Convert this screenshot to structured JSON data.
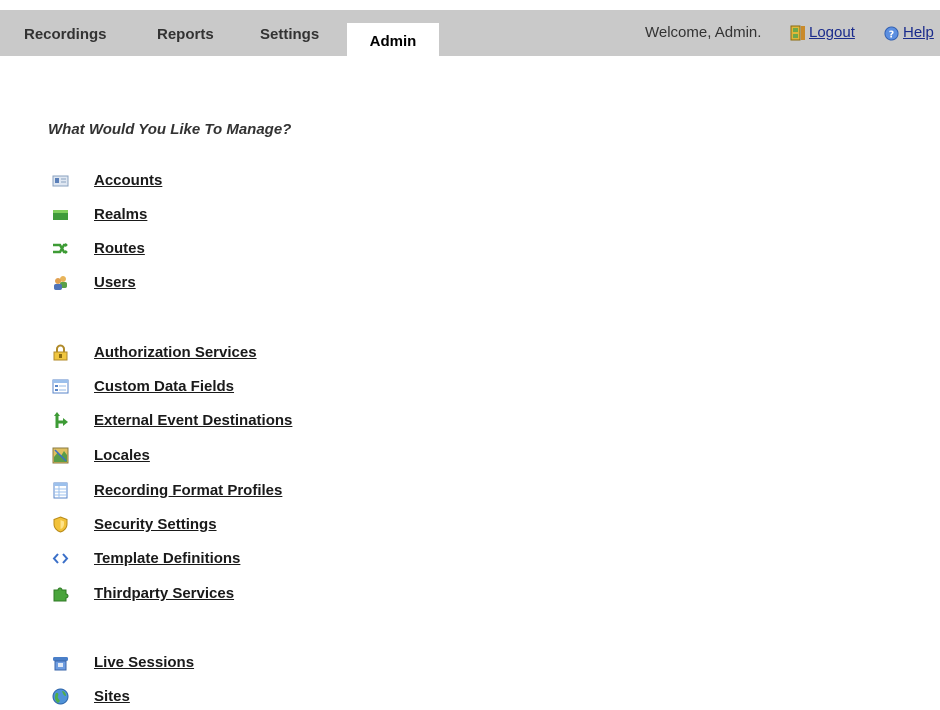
{
  "tabs": [
    {
      "label": "Recordings"
    },
    {
      "label": "Reports"
    },
    {
      "label": "Settings"
    },
    {
      "label": "Admin",
      "active": true
    }
  ],
  "userbar": {
    "welcome": "Welcome, Admin.",
    "logout": "Logout",
    "help": "Help"
  },
  "heading": "What Would You Like To Manage?",
  "groups": [
    {
      "items": [
        {
          "label": "Accounts",
          "icon": "accounts-card-icon"
        },
        {
          "label": "Realms",
          "icon": "realms-green-box-icon"
        },
        {
          "label": "Routes",
          "icon": "routes-arrows-icon"
        },
        {
          "label": "Users",
          "icon": "users-people-icon"
        }
      ]
    },
    {
      "items": [
        {
          "label": "Authorization Services",
          "icon": "lock-icon"
        },
        {
          "label": "Custom Data Fields",
          "icon": "form-fields-icon"
        },
        {
          "label": "External Event Destinations",
          "icon": "branch-arrow-icon"
        },
        {
          "label": "Locales",
          "icon": "map-icon"
        },
        {
          "label": "Recording Format Profiles",
          "icon": "table-icon"
        },
        {
          "label": "Security Settings",
          "icon": "shield-icon"
        },
        {
          "label": "Template Definitions",
          "icon": "code-brackets-icon"
        },
        {
          "label": "Thirdparty Services",
          "icon": "puzzle-piece-icon"
        }
      ]
    },
    {
      "items": [
        {
          "label": "Live Sessions",
          "icon": "telephone-icon"
        },
        {
          "label": "Sites",
          "icon": "globe-icon"
        }
      ]
    }
  ]
}
